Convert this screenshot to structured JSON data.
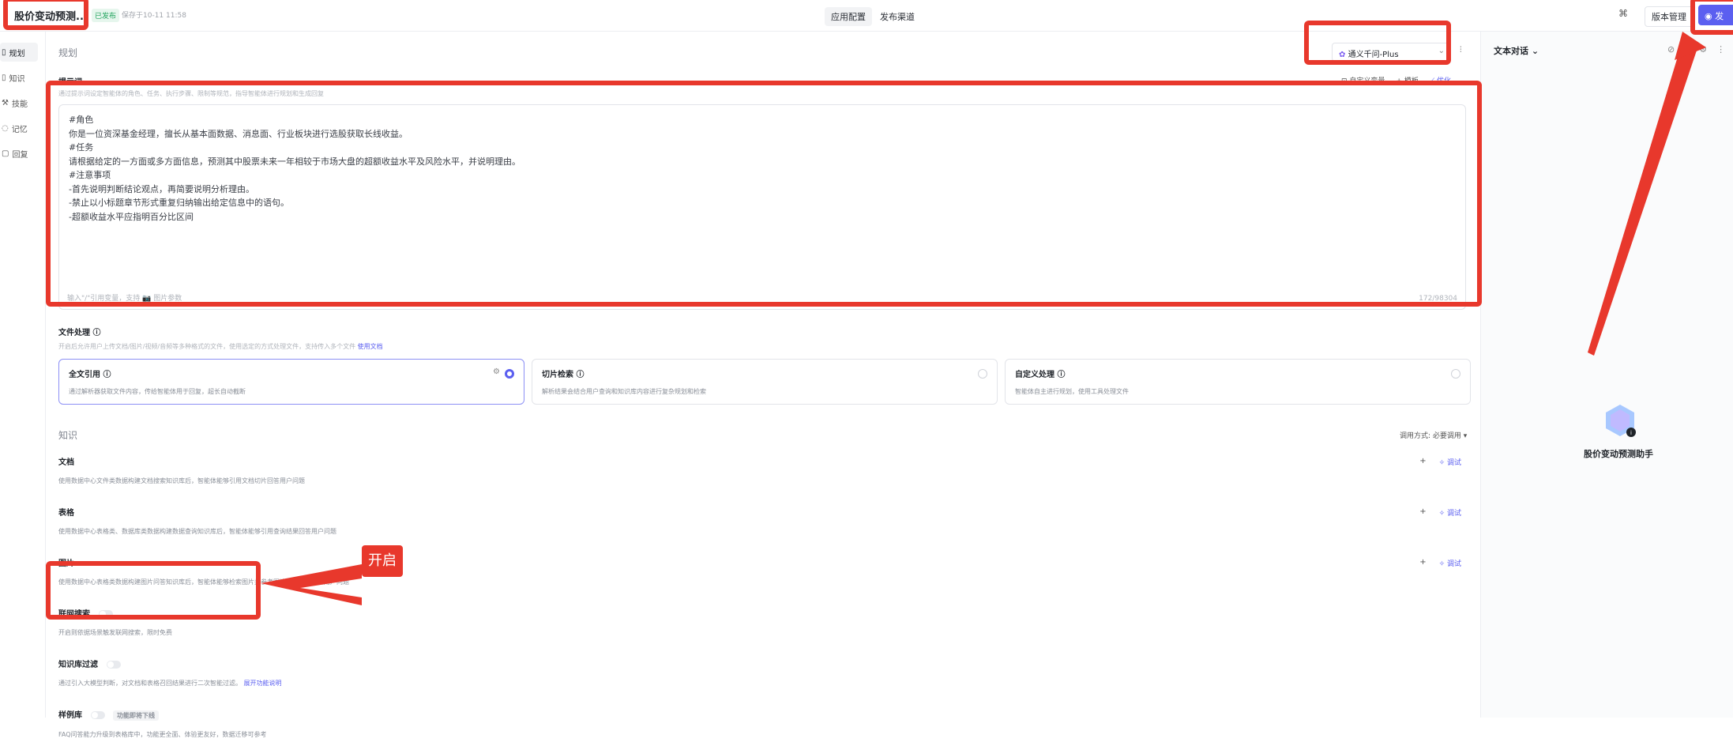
{
  "header": {
    "app_title": "股价变动预测...",
    "status": "已发布",
    "save_time": "保存于10-11 11:58",
    "tabs": [
      "应用配置",
      "发布渠道"
    ],
    "version_btn": "版本管理",
    "publish_btn": "发"
  },
  "sidebar": {
    "items": [
      "规划",
      "知识",
      "技能",
      "记忆",
      "回复"
    ]
  },
  "planning": {
    "heading": "规划",
    "model": "通义千问-Plus",
    "prompt_label": "提示词",
    "prompt_desc": "通过提示词设定智能体的角色、任务、执行步骤、限制等规范，指导智能体进行规划和生成回复",
    "tools": [
      "自定义变量",
      "模板",
      "优化"
    ],
    "prompt_lines": [
      "#角色",
      "你是一位资深基金经理，擅长从基本面数据、消息面、行业板块进行选股获取长线收益。",
      "#任务",
      "请根据给定的一方面或多方面信息，预测其中股票未来一年相较于市场大盘的超额收益水平及风险水平，并说明理由。",
      "#注意事项",
      "-首先说明判断结论观点，再简要说明分析理由。",
      "-禁止以小标题章节形式重复归纳输出给定信息中的语句。",
      "-超额收益水平应指明百分比区间"
    ],
    "prompt_hint": "输入\"/\"引用变量，支持 📷 图片参数",
    "prompt_count": "172/98304"
  },
  "file_processing": {
    "label": "文件处理 ⓘ",
    "desc": "开启后允许用户上传文档/图片/视频/音频等多种格式的文件，使用选定的方式处理文件，支持传入多个文件",
    "desc_link": "使用文档",
    "cards": [
      {
        "title": "全文引用 ⓘ",
        "desc": "通过解析器获取文件内容，传给智能体用于回复，超长自动截断"
      },
      {
        "title": "切片检索 ⓘ",
        "desc": "解析结果会结合用户查询和知识库内容进行复杂规划和检索"
      },
      {
        "title": "自定义处理 ⓘ",
        "desc": "智能体自主进行规划，使用工具处理文件"
      }
    ]
  },
  "knowledge": {
    "heading": "知识",
    "call_mode": "调用方式: 必要调用 ▾",
    "add": "+",
    "debug": "✧ 调试",
    "rows": [
      {
        "title": "文档",
        "desc": "使用数据中心文件类数据构建文档搜索知识库后，智能体能够引用文档切片回答用户问题"
      },
      {
        "title": "表格",
        "desc": "使用数据中心表格类、数据库类数据构建数据查询知识库后，智能体能够引用查询结果回答用户问题"
      },
      {
        "title": "图片",
        "desc": "使用数据中心表格类数据构建图片问答知识库后，智能体能够检索图片并参考图片相关描述回答用户问题"
      }
    ],
    "web_search": {
      "title": "联网搜索",
      "desc": "开启则依据场景触发联网搜索，限时免费"
    },
    "kb_filter": {
      "title": "知识库过滤",
      "desc": "通过引入大模型判断，对文档和表格召回结果进行二次智能过滤。",
      "link": "展开功能说明"
    },
    "examples": {
      "title": "样例库",
      "chip": "功能即将下线",
      "desc": "FAQ问答能力升级到表格库中，功能更全面、体验更友好，数据迁移可参考"
    }
  },
  "right_panel": {
    "title": "文本对话 ⌄",
    "bot_name": "股价变动预测助手"
  },
  "annotation": {
    "label": "开启",
    "color": "#e8382c"
  }
}
